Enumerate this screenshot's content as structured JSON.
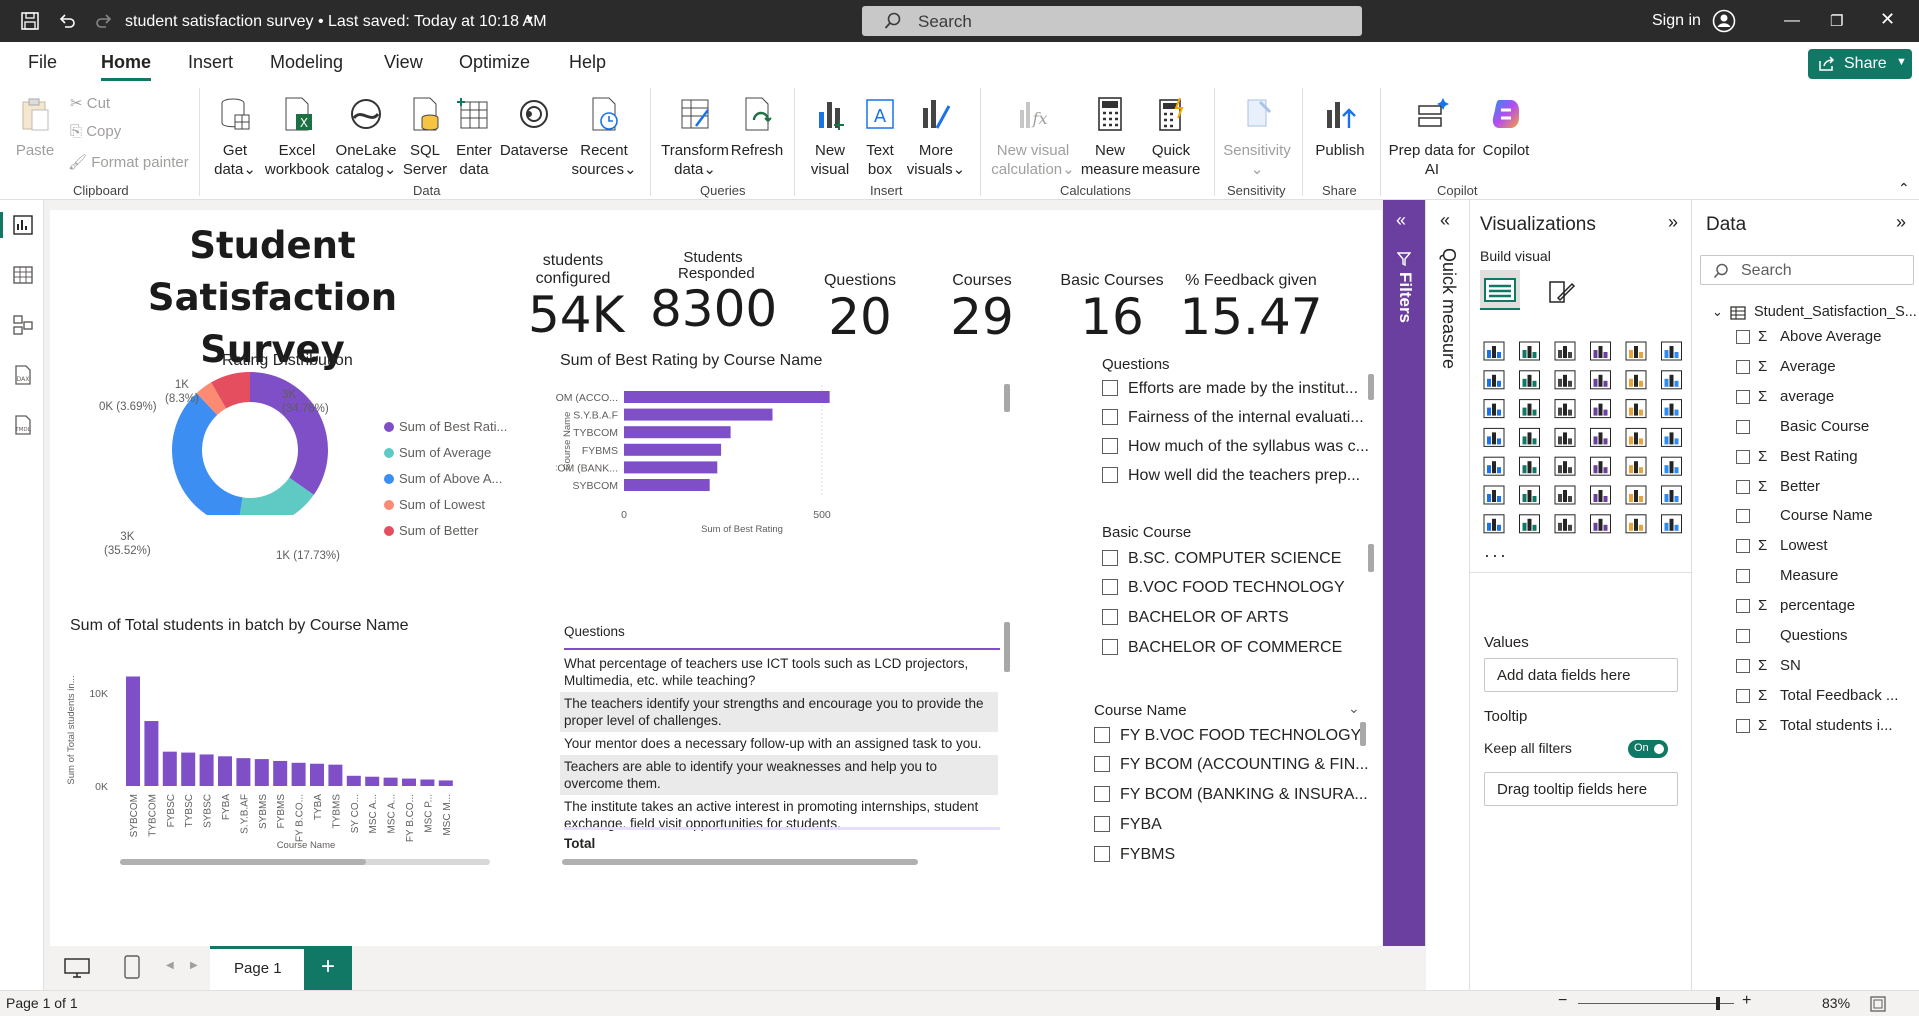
{
  "titlebar": {
    "doc_title": "student satisfaction survey  •  Last saved: Today at 10:18 AM",
    "search_placeholder": "Search",
    "signin": "Sign in"
  },
  "menu": {
    "tabs": [
      "File",
      "Home",
      "Insert",
      "Modeling",
      "View",
      "Optimize",
      "Help"
    ],
    "active": "Home",
    "share": "Share"
  },
  "ribbon": {
    "clipboard": {
      "paste": "Paste",
      "cut": "Cut",
      "copy": "Copy",
      "format_painter": "Format painter",
      "group": "Clipboard"
    },
    "data": {
      "get_data": [
        "Get",
        "data"
      ],
      "excel": [
        "Excel",
        "workbook"
      ],
      "onelake": [
        "OneLake",
        "catalog"
      ],
      "sql": [
        "SQL",
        "Server"
      ],
      "enter": [
        "Enter",
        "data"
      ],
      "dataverse": [
        "Dataverse",
        ""
      ],
      "recent": [
        "Recent",
        "sources"
      ],
      "group": "Data"
    },
    "queries": {
      "transform": [
        "Transform",
        "data"
      ],
      "refresh": [
        "Refresh",
        ""
      ],
      "group": "Queries"
    },
    "insert": {
      "new_visual": [
        "New",
        "visual"
      ],
      "text_box": [
        "Text",
        "box"
      ],
      "more_visuals": [
        "More",
        "visuals"
      ],
      "group": "Insert"
    },
    "calculations": {
      "new_visual_calc": [
        "New visual",
        "calculation"
      ],
      "new_measure": [
        "New",
        "measure"
      ],
      "quick_measure": [
        "Quick",
        "measure"
      ],
      "group": "Calculations"
    },
    "sensitivity": {
      "label": [
        "Sensitivity",
        ""
      ],
      "group": "Sensitivity"
    },
    "share": {
      "publish": [
        "Publish",
        ""
      ],
      "group": "Share"
    },
    "copilot": {
      "prep": [
        "Prep data for",
        "AI"
      ],
      "copilot": [
        "Copilot",
        ""
      ],
      "group": "Copilot"
    }
  },
  "report": {
    "title": "Student Satisfaction Survey",
    "kpis": [
      {
        "label": "students configured",
        "value": "54K"
      },
      {
        "label": "Students Responded",
        "value": "8300"
      },
      {
        "label": "Questions",
        "value": "20"
      },
      {
        "label": "Courses",
        "value": "29"
      },
      {
        "label": "Basic Courses",
        "value": "16"
      },
      {
        "label": "% Feedback given",
        "value": "15.47"
      }
    ],
    "donut": {
      "title": "Rating Distribution",
      "slice_labels": [
        "3K\n(34.76%)",
        "1K (17.73%)",
        "3K\n(35.52%)",
        "0K (3.69%)",
        "1K\n(8.3%)"
      ],
      "legend": [
        "Sum of Best Rati...",
        "Sum of Average",
        "Sum of Above A...",
        "Sum of Lowest",
        "Sum of Better"
      ]
    },
    "hbar": {
      "title": "Sum of Best Rating by Course Name",
      "ylabel": "Course Name",
      "xlabel": "Sum of Best Rating",
      "ticks": [
        "0",
        "500"
      ]
    },
    "vbar": {
      "title": "Sum of Total students in batch by Course Name",
      "ylabel": "Sum of Total students in...",
      "xlabel": "Course Name",
      "ticks": [
        "10K",
        "0K"
      ]
    },
    "questions_slicer": {
      "title": "Questions",
      "items": [
        "Efforts are made by the institut...",
        "Fairness of the internal evaluati...",
        "How much of the syllabus was c...",
        "How well did the teachers prep..."
      ]
    },
    "basic_course_slicer": {
      "title": "Basic Course",
      "items": [
        "B.SC. COMPUTER SCIENCE",
        "B.VOC FOOD TECHNOLOGY",
        "BACHELOR OF ARTS",
        "BACHELOR OF COMMERCE"
      ]
    },
    "course_name_slicer": {
      "title": "Course Name",
      "items": [
        "FY B.VOC FOOD TECHNOLOGY",
        "FY BCOM (ACCOUNTING & FIN...",
        "FY BCOM (BANKING & INSURA...",
        "FYBA",
        "FYBMS"
      ]
    },
    "questions_table": {
      "header": "Questions",
      "rows": [
        "What percentage of teachers use ICT tools such as LCD projectors, Multimedia, etc. while teaching?",
        "The teachers identify your strengths and encourage you to provide the proper level of challenges.",
        "Your mentor does a necessary follow-up with an assigned task to you.",
        "Teachers are able to identify your weaknesses and help you to overcome them.",
        "The institute takes an active interest in promoting internships, student exchange, field visit opportunities for students."
      ],
      "total": "Total"
    }
  },
  "chart_data": [
    {
      "type": "pie",
      "title": "Rating Distribution",
      "categories": [
        "Sum of Best Rating",
        "Sum of Average",
        "Sum of Above Average",
        "Sum of Lowest",
        "Sum of Better"
      ],
      "values": [
        34.76,
        17.73,
        35.52,
        3.69,
        8.3
      ],
      "colors": [
        "#7e4fc7",
        "#5ecac3",
        "#3c8ef2",
        "#fd8a73",
        "#e44e5e"
      ]
    },
    {
      "type": "bar",
      "title": "Sum of Best Rating by Course Name",
      "categories": [
        "FY BCOM (ACCO...",
        "S.Y.B.A.F",
        "TYBCOM",
        "FYBMS",
        "FY BCOM (BANK...",
        "SYBCOM"
      ],
      "values": [
        540,
        390,
        280,
        255,
        245,
        225
      ],
      "xlim": [
        0,
        550
      ],
      "xlabel": "Sum of Best Rating",
      "ylabel": "Course Name"
    },
    {
      "type": "bar",
      "title": "Sum of Total students in batch by Course Name",
      "categories": [
        "SYBCOM",
        "TYBCOM",
        "FYBSC",
        "TYBSC",
        "SYBSC",
        "FYBA",
        "S.Y.B.AF",
        "SYBMS",
        "FYBMS",
        "FY B.CO...",
        "TYBA",
        "TYBMS",
        "SY CO...",
        "MSC A...",
        "MSC A...",
        "FY B.CO...",
        "MSC P...",
        "MSC M..."
      ],
      "values": [
        11800,
        7000,
        3700,
        3600,
        3400,
        3200,
        3000,
        2900,
        2700,
        2500,
        2400,
        2300,
        1100,
        1000,
        900,
        800,
        700,
        600
      ],
      "ylim": [
        0,
        12500
      ],
      "xlabel": "Course Name",
      "ylabel": "Sum of Total students in..."
    }
  ],
  "pagebar": {
    "page": "Page 1",
    "add": "+"
  },
  "statusbar": {
    "page_info": "Page 1 of 1",
    "zoom": "83%"
  },
  "filters": {
    "label": "Filters"
  },
  "quick_measure": {
    "label": "Quick measure"
  },
  "viz_pane": {
    "title": "Visualizations",
    "build_visual": "Build visual",
    "values": "Values",
    "values_well": "Add data fields here",
    "tooltip": "Tooltip",
    "keep_filters": "Keep all filters",
    "toggle": "On",
    "tooltip_well": "Drag tooltip fields here"
  },
  "data_pane": {
    "title": "Data",
    "search_placeholder": "Search",
    "table": "Student_Satisfaction_S...",
    "fields": [
      {
        "name": "Above Average",
        "sigma": true
      },
      {
        "name": "Average",
        "sigma": true
      },
      {
        "name": "average",
        "sigma": true
      },
      {
        "name": "Basic Course",
        "sigma": false
      },
      {
        "name": "Best Rating",
        "sigma": true
      },
      {
        "name": "Better",
        "sigma": true
      },
      {
        "name": "Course Name",
        "sigma": false
      },
      {
        "name": "Lowest",
        "sigma": true
      },
      {
        "name": "Measure",
        "sigma": false
      },
      {
        "name": "percentage",
        "sigma": true
      },
      {
        "name": "Questions",
        "sigma": false
      },
      {
        "name": "SN",
        "sigma": true
      },
      {
        "name": "Total Feedback ...",
        "sigma": true
      },
      {
        "name": "Total students i...",
        "sigma": true
      }
    ]
  },
  "colors": {
    "accent": "#117865",
    "purple": "#7e4fc7",
    "filters": "#6a3fa0"
  }
}
